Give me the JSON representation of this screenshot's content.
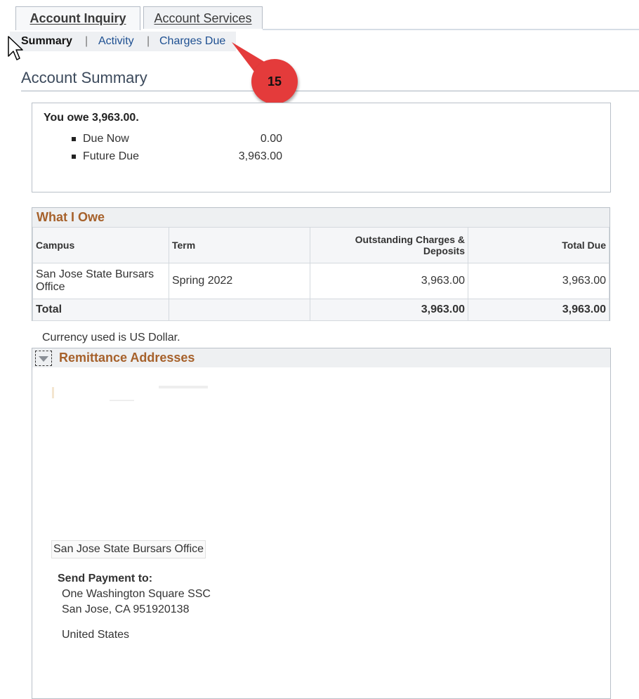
{
  "tabs": {
    "account_inquiry": "Account Inquiry",
    "account_services": "Account Services"
  },
  "subnav": {
    "summary": "Summary",
    "separator": "|",
    "activity": "Activity",
    "charges_due": "Charges Due"
  },
  "page": {
    "title": "Account Summary"
  },
  "callout": {
    "number": "15",
    "color": "#e43b3b"
  },
  "summary": {
    "headline": "You owe 3,963.00.",
    "items": [
      {
        "label": "Due Now",
        "value": "0.00"
      },
      {
        "label": "Future Due",
        "value": "3,963.00"
      }
    ]
  },
  "what_i_owe": {
    "title": "What I Owe",
    "columns": [
      "Campus",
      "Term",
      "Outstanding Charges & Deposits",
      "Total Due"
    ],
    "rows": [
      {
        "campus": "San Jose State Bursars Office",
        "term": "Spring 2022",
        "outstanding": "3,963.00",
        "total_due": "3,963.00"
      }
    ],
    "total": {
      "label": "Total",
      "outstanding": "3,963.00",
      "total_due": "3,963.00"
    }
  },
  "currency_note": "Currency used is US Dollar.",
  "remittance": {
    "title": "Remittance Addresses",
    "office": "San Jose State Bursars Office",
    "send_label": "Send Payment to:",
    "address_line1": "One Washington Square  SSC",
    "address_line2": "San Jose, CA 951920138",
    "country": "United States"
  },
  "colors": {
    "section_title": "#a6612b",
    "link": "#1d4f91"
  }
}
